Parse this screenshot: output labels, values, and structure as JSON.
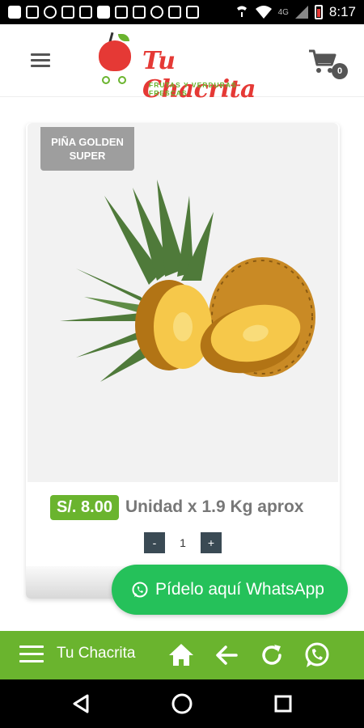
{
  "status_bar": {
    "network": "4G",
    "time": "8:17"
  },
  "header": {
    "brand_title": "Tu Chacrita",
    "brand_tagline": "FRUTAS Y VERDURAS FRESCAS",
    "cart_count": "0",
    "icons": [
      "menu-icon",
      "cart-icon"
    ]
  },
  "product": {
    "badge_line1": "PIÑA GOLDEN",
    "badge_line2": "SUPER",
    "price": "S/. 8.00",
    "unit": "Unidad x 1.9 Kg aprox",
    "qty_minus": "-",
    "quantity": "1",
    "qty_plus": "+",
    "image": "pineapple-image"
  },
  "whatsapp_cta": {
    "label": "Pídelo aquí WhatsApp"
  },
  "bottom_bar": {
    "title": "Tu Chacrita",
    "icons": [
      "menu-icon",
      "home-icon",
      "back-arrow-icon",
      "refresh-icon",
      "whatsapp-icon"
    ]
  },
  "colors": {
    "accent_green": "#6ab42e",
    "whatsapp_green": "#25c15a",
    "brand_red": "#e53935",
    "badge_gray": "#9e9e9e",
    "qty_dark": "#3a4a54"
  }
}
